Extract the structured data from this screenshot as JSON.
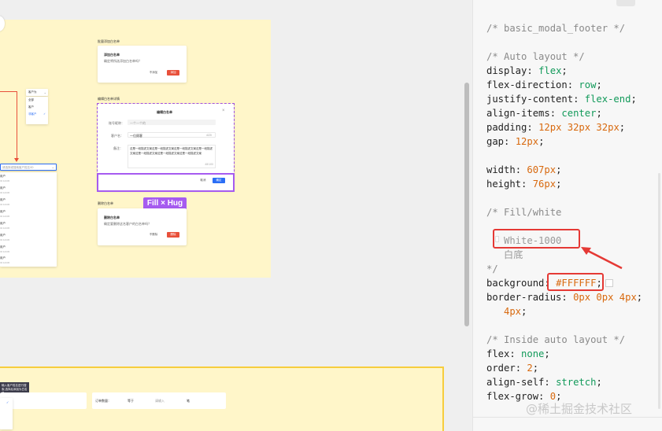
{
  "canvas": {
    "frame_titles": {
      "confirm_add": "批量添加白名单",
      "edit": "编辑白名单详情",
      "delete": "删除白名单"
    },
    "confirm_modal": {
      "title": "添加白名单",
      "body": "确定将所选添加白名单吗？",
      "cancel": "不添加",
      "ok": "添加"
    },
    "edit_modal": {
      "title": "编辑白名单",
      "close": "×",
      "fields": [
        {
          "label": "账号昵称：",
          "value": "一个一个的"
        },
        {
          "label": "客户名：",
          "value": "一位顾客",
          "count": "4/20"
        },
        {
          "label": "备注：",
          "value": "这是一段描述文案这是一段描述文案这是一段描述文案这是一段描述文案这是一段描述文案这是一段描述文案这是一段描述文案",
          "count": "48/100"
        }
      ],
      "cancel": "取消",
      "ok": "确定"
    },
    "delete_modal": {
      "title": "删除白名单",
      "body": "确定要删除这名客户的白名单吗？",
      "cancel": "不删除",
      "ok": "删除"
    },
    "fill_hug": "Fill × Hug",
    "dropdown_small": {
      "selected": "客户为",
      "items": [
        "全部",
        "客户",
        "非客户"
      ]
    },
    "select_placeholder": "请选择或搜索客户姓名/ID",
    "list_items": [
      {
        "name": "用户",
        "sub": "ID:12345"
      },
      {
        "name": "用户",
        "sub": "ID:12345"
      },
      {
        "name": "用户",
        "sub": "ID:12345"
      },
      {
        "name": "用户",
        "sub": "ID:12345"
      },
      {
        "name": "用户",
        "sub": "ID:12345"
      },
      {
        "name": "用户",
        "sub": "ID:12345"
      },
      {
        "name": "用户",
        "sub": "ID:12345"
      },
      {
        "name": "用户",
        "sub": "ID:12345"
      }
    ],
    "tooltip": "输入客户姓名进行搜索,选择后添加为白名单",
    "bottom_filter": {
      "label": "订单数量：",
      "operator": "等于",
      "placeholder": "请输入",
      "unit": "笔"
    }
  },
  "code_panel": {
    "lines": [
      {
        "t": "c",
        "text": "/* basic_modal_footer */"
      },
      {
        "t": "blank"
      },
      {
        "t": "c",
        "text": "/* Auto layout */"
      },
      {
        "t": "kv",
        "prop": "display",
        "val": "flex",
        "kind": "v"
      },
      {
        "t": "kv",
        "prop": "flex-direction",
        "val": "row",
        "kind": "v"
      },
      {
        "t": "kv",
        "prop": "justify-content",
        "val": "flex-end",
        "kind": "v"
      },
      {
        "t": "kv",
        "prop": "align-items",
        "val": "center",
        "kind": "v"
      },
      {
        "t": "kv",
        "prop": "padding",
        "val": "12px 32px 32px",
        "kind": "n"
      },
      {
        "t": "kv",
        "prop": "gap",
        "val": "12px",
        "kind": "n"
      },
      {
        "t": "blank"
      },
      {
        "t": "kv",
        "prop": "width",
        "val": "607px",
        "kind": "n"
      },
      {
        "t": "kv",
        "prop": "height",
        "val": "76px",
        "kind": "n"
      },
      {
        "t": "blank"
      },
      {
        "t": "c",
        "text": "/* Fill/white"
      },
      {
        "t": "blank"
      },
      {
        "t": "w",
        "text": "   White-1000"
      },
      {
        "t": "w",
        "text": "   白底"
      },
      {
        "t": "c",
        "text": "*/"
      },
      {
        "t": "kv",
        "prop": "background",
        "val": "#FFFFFF",
        "kind": "h"
      },
      {
        "t": "kv",
        "prop": "border-radius",
        "val": "0px 0px 4px",
        "kind": "n"
      },
      {
        "t": "cont",
        "val": "   4px",
        "kind": "n"
      },
      {
        "t": "blank"
      },
      {
        "t": "c",
        "text": "/* Inside auto layout */"
      },
      {
        "t": "kv",
        "prop": "flex",
        "val": "none",
        "kind": "v"
      },
      {
        "t": "kv",
        "prop": "order",
        "val": "2",
        "kind": "n"
      },
      {
        "t": "kv",
        "prop": "align-self",
        "val": "stretch",
        "kind": "v"
      },
      {
        "t": "kv",
        "prop": "flex-grow",
        "val": "0",
        "kind": "n"
      }
    ],
    "watermark": "@稀土掘金技术社区"
  },
  "colors": {
    "highlight": "#e53935",
    "purple": "#a65bf0",
    "yellow_frame": "#fff6c9"
  }
}
